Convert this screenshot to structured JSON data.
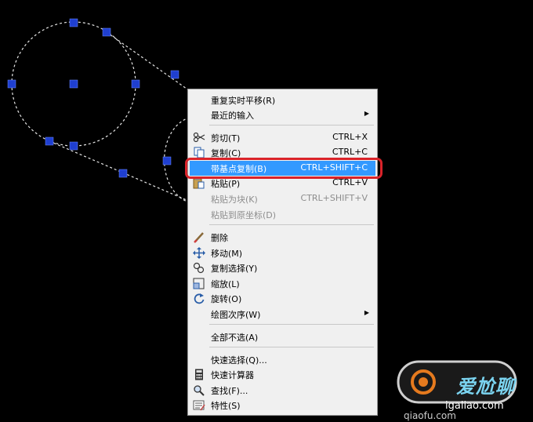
{
  "menu": {
    "items": [
      {
        "label": "重复实时平移(R)",
        "accel": "",
        "submenu": false,
        "disabled": false,
        "icon": ""
      },
      {
        "label": "最近的输入",
        "accel": "",
        "submenu": true,
        "disabled": false,
        "icon": ""
      },
      {
        "label": "剪切(T)",
        "accel": "CTRL+X",
        "submenu": false,
        "disabled": false,
        "icon": "scissors-icon"
      },
      {
        "label": "复制(C)",
        "accel": "CTRL+C",
        "submenu": false,
        "disabled": false,
        "icon": "copy-icon"
      },
      {
        "label": "带基点复制(B)",
        "accel": "CTRL+SHIFT+C",
        "submenu": false,
        "disabled": false,
        "icon": "",
        "highlight": true
      },
      {
        "label": "粘贴(P)",
        "accel": "CTRL+V",
        "submenu": false,
        "disabled": false,
        "icon": "paste-icon"
      },
      {
        "label": "粘贴为块(K)",
        "accel": "CTRL+SHIFT+V",
        "submenu": false,
        "disabled": true,
        "icon": ""
      },
      {
        "label": "粘贴到原坐标(D)",
        "accel": "",
        "submenu": false,
        "disabled": true,
        "icon": ""
      },
      {
        "label": "删除",
        "accel": "",
        "submenu": false,
        "disabled": false,
        "icon": "eraser-icon"
      },
      {
        "label": "移动(M)",
        "accel": "",
        "submenu": false,
        "disabled": false,
        "icon": "move-icon"
      },
      {
        "label": "复制选择(Y)",
        "accel": "",
        "submenu": false,
        "disabled": false,
        "icon": "copy-select-icon"
      },
      {
        "label": "缩放(L)",
        "accel": "",
        "submenu": false,
        "disabled": false,
        "icon": "scale-icon"
      },
      {
        "label": "旋转(O)",
        "accel": "",
        "submenu": false,
        "disabled": false,
        "icon": "rotate-icon"
      },
      {
        "label": "绘图次序(W)",
        "accel": "",
        "submenu": true,
        "disabled": false,
        "icon": ""
      },
      {
        "label": "全部不选(A)",
        "accel": "",
        "submenu": false,
        "disabled": false,
        "icon": ""
      },
      {
        "label": "快速选择(Q)...",
        "accel": "",
        "submenu": false,
        "disabled": false,
        "icon": ""
      },
      {
        "label": "快速计算器",
        "accel": "",
        "submenu": false,
        "disabled": false,
        "icon": "calculator-icon"
      },
      {
        "label": "查找(F)...",
        "accel": "",
        "submenu": false,
        "disabled": false,
        "icon": "find-icon"
      },
      {
        "label": "特性(S)",
        "accel": "",
        "submenu": false,
        "disabled": false,
        "icon": "properties-icon"
      }
    ]
  },
  "watermark": {
    "brand": "爱尬聊",
    "site": "igaliao.com",
    "sub": "qiaofu.com"
  },
  "colors": {
    "highlight": "#3399ff",
    "outline": "#d9232a",
    "grip": "#1f3fd0"
  }
}
